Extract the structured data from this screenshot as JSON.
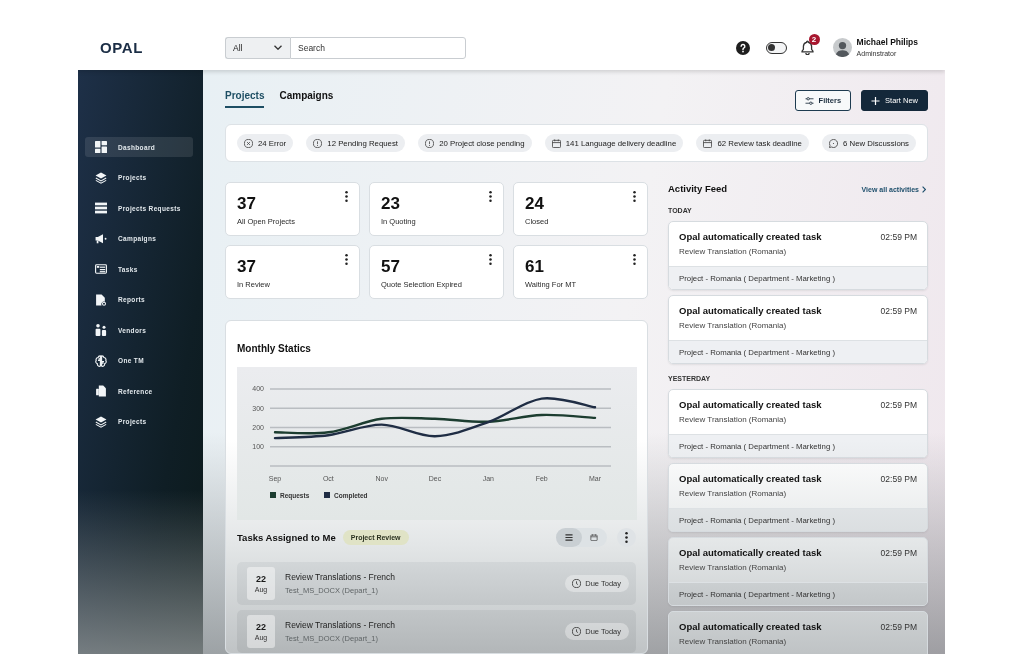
{
  "header": {
    "logo": "OPAL",
    "search": {
      "scope": "All",
      "placeholder": "Search"
    },
    "theme_toggle": {
      "on": false
    },
    "notifications": {
      "count": "2"
    },
    "user": {
      "name": "Michael Philips",
      "role": "Adminstrator"
    }
  },
  "sidebar": {
    "items": [
      {
        "label": "Dashboard",
        "selected": true
      },
      {
        "label": "Projects",
        "selected": false
      },
      {
        "label": "Projects Requests",
        "selected": false
      },
      {
        "label": "Campaigns",
        "selected": false
      },
      {
        "label": "Tasks",
        "selected": false
      },
      {
        "label": "Reports",
        "selected": false
      },
      {
        "label": "Vendors",
        "selected": false
      },
      {
        "label": "One TM",
        "selected": false
      },
      {
        "label": "Reference",
        "selected": false
      },
      {
        "label": "Projects",
        "selected": false
      }
    ]
  },
  "tabs": [
    {
      "label": "Projects",
      "selected": true
    },
    {
      "label": "Campaigns",
      "selected": false
    }
  ],
  "toolbar": {
    "buttons": [
      {
        "kind": "filter",
        "label": "Filters"
      },
      {
        "kind": "create",
        "label": "Start New"
      }
    ]
  },
  "summary_chips": [
    {
      "kind": "error",
      "label": "24 Error"
    },
    {
      "kind": "alert",
      "label": "12 Pending Request"
    },
    {
      "kind": "alert",
      "label": "20 Project close pending"
    },
    {
      "kind": "deadline",
      "label": "141 Language delivery deadline"
    },
    {
      "kind": "deadline",
      "label": "62 Review task deadline"
    },
    {
      "kind": "discussion",
      "label": "6 New Discussions"
    }
  ],
  "stats": [
    {
      "value": "37",
      "label": "All Open Projects"
    },
    {
      "value": "23",
      "label": "In Quoting"
    },
    {
      "value": "24",
      "label": "Closed"
    },
    {
      "value": "37",
      "label": "In Review"
    },
    {
      "value": "57",
      "label": "Quote Selection Expired"
    },
    {
      "value": "61",
      "label": "Waiting For MT"
    }
  ],
  "monthly_statistics": {
    "chart_data": {
      "type": "line",
      "title": "Monthly Statics",
      "categories": [
        "Sep",
        "Oct",
        "Nov",
        "Dec",
        "Jan",
        "Feb",
        "Mar"
      ],
      "series": [
        {
          "name": "Requests",
          "color": "#1c3d30",
          "values": [
            175,
            175,
            245,
            245,
            230,
            265,
            250
          ]
        },
        {
          "name": "Completed",
          "color": "#1f2d44",
          "values": [
            145,
            160,
            215,
            155,
            228,
            350,
            305
          ]
        }
      ],
      "ylim": [
        0,
        400
      ],
      "yticks": [
        100,
        200,
        300,
        400
      ],
      "grid": true,
      "legend": true
    }
  },
  "tasks": {
    "title": "Tasks Assigned to Me",
    "filter": "Project Review",
    "view_modes": [
      {
        "kind": "list",
        "selected": true
      },
      {
        "kind": "calendar",
        "selected": false
      }
    ],
    "items": [
      {
        "day": "22",
        "month": "Aug",
        "title": "Review Translations - French",
        "subtitle": "Test_MS_DOCX (Depart_1)",
        "due": "Due Today"
      },
      {
        "day": "22",
        "month": "Aug",
        "title": "Review Translations - French",
        "subtitle": "Test_MS_DOCX (Depart_1)",
        "due": "Due Today"
      }
    ]
  },
  "activity_feed": {
    "title": "Activity Feed",
    "link": "View all activities",
    "groups": [
      {
        "label": "TODAY",
        "items": [
          {
            "title": "Opal automatically created task",
            "time": "02:59 PM",
            "detail": "Review Translation (Romania)",
            "project": "Project - Romania ( Department - Marketing )"
          },
          {
            "title": "Opal automatically created task",
            "time": "02:59 PM",
            "detail": "Review Translation (Romania)",
            "project": "Project - Romania ( Department - Marketing )"
          }
        ]
      },
      {
        "label": "YESTERDAY",
        "items": [
          {
            "title": "Opal automatically created task",
            "time": "02:59 PM",
            "detail": "Review Translation (Romania)",
            "project": "Project - Romania ( Department - Marketing )"
          },
          {
            "title": "Opal automatically created task",
            "time": "02:59 PM",
            "detail": "Review Translation (Romania)",
            "project": "Project - Romania ( Department - Marketing )"
          },
          {
            "title": "Opal automatically created task",
            "time": "02:59 PM",
            "detail": "Review Translation (Romania)",
            "project": "Project - Romania ( Department - Marketing )"
          },
          {
            "title": "Opal automatically created task",
            "time": "02:59 PM",
            "detail": "Review Translation (Romania)"
          }
        ]
      }
    ]
  }
}
